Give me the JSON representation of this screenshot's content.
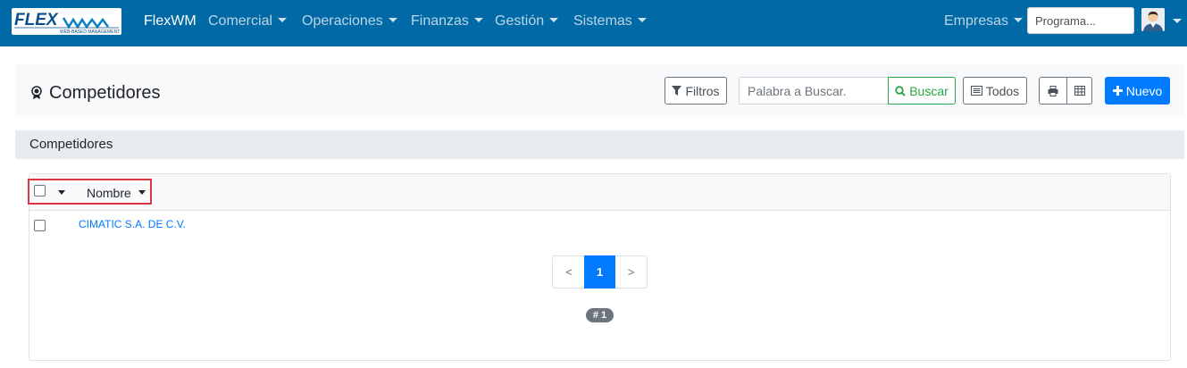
{
  "navbar": {
    "logo_text": "FLEXWM",
    "logo_tagline": "WEB-BASED MANAGEMENT",
    "brand": "FlexWM",
    "menus": [
      "Comercial",
      "Operaciones",
      "Finanzas",
      "Gestión",
      "Sistemas"
    ],
    "empresas": "Empresas",
    "program_placeholder": "Programa...",
    "background_color": "#0069a6"
  },
  "page": {
    "title": "Competidores",
    "title_icon": "award-icon"
  },
  "toolbar": {
    "filters_label": "Filtros",
    "search_placeholder": "Palabra a Buscar.",
    "search_button_label": "Buscar",
    "all_label": "Todos",
    "new_label": "Nuevo",
    "print_icon": "print-icon",
    "grid_icon": "table-icon",
    "accent_color": "#007bff",
    "search_color": "#28a745"
  },
  "section": {
    "title": "Competidores"
  },
  "table": {
    "columns": [
      "Nombre"
    ],
    "rows": [
      {
        "nombre": "CIMATIC S.A. DE C.V."
      }
    ],
    "highlight_color": "#dc3545"
  },
  "pagination": {
    "prev": "<",
    "current": "1",
    "next": ">",
    "count_badge": "# 1"
  }
}
